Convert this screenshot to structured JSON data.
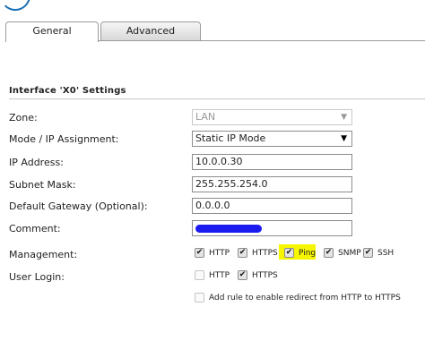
{
  "tabs": [
    {
      "label": "General",
      "active": true
    },
    {
      "label": "Advanced",
      "active": false
    }
  ],
  "section_title": "Interface 'X0' Settings",
  "fields": {
    "zone": {
      "label": "Zone:",
      "value": "LAN",
      "disabled": true
    },
    "mode": {
      "label": "Mode / IP Assignment:",
      "value": "Static IP Mode"
    },
    "ip": {
      "label": "IP Address:",
      "value": "10.0.0.30"
    },
    "subnet": {
      "label": "Subnet Mask:",
      "value": "255.255.254.0"
    },
    "gateway": {
      "label": "Default Gateway (Optional):",
      "value": "0.0.0.0"
    },
    "comment": {
      "label": "Comment:",
      "value": ""
    }
  },
  "management": {
    "label": "Management:",
    "options": [
      {
        "label": "HTTP",
        "checked": true
      },
      {
        "label": "HTTPS",
        "checked": true
      },
      {
        "label": "Ping",
        "checked": true,
        "highlighted": true
      },
      {
        "label": "SNMP",
        "checked": true
      },
      {
        "label": "SSH",
        "checked": true
      }
    ]
  },
  "user_login": {
    "label": "User Login:",
    "options": [
      {
        "label": "HTTP",
        "checked": false
      },
      {
        "label": "HTTPS",
        "checked": true
      }
    ]
  },
  "redirect": {
    "label": "Add rule to enable redirect from HTTP to HTTPS",
    "checked": false
  },
  "colors": {
    "highlight": "#f6f600",
    "redaction": "#1b1bf0",
    "tab_border": "#9a9a9a"
  }
}
